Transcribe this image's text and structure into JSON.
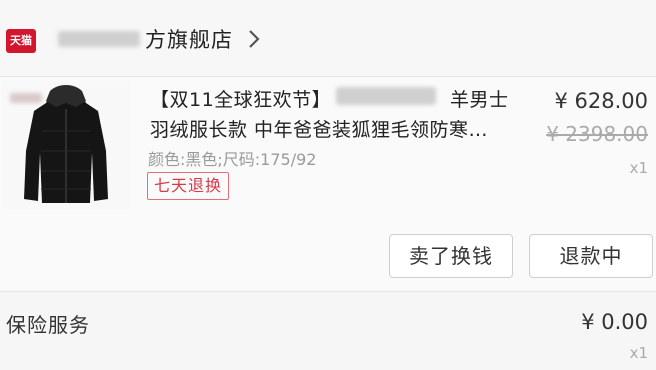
{
  "store": {
    "logo_text": "天猫",
    "name": "方旗舰店"
  },
  "product": {
    "title_line1_start": "【双11全球狂欢节】",
    "title_line1_end": "羊男士",
    "title_line2": "羽绒服长款 中年爸爸装狐狸毛领防寒…",
    "spec": "颜色:黑色;尺码:175/92",
    "return_tag": "七天退换",
    "price": "¥ 628.00",
    "original_price": "¥ 2398.00",
    "quantity": "x1"
  },
  "actions": {
    "sell_label": "卖了换钱",
    "refund_label": "退款中"
  },
  "service": {
    "label": "保险服务",
    "price": "¥ 0.00",
    "quantity": "x1"
  },
  "colors": {
    "tmall_red": "#d4152e",
    "tag_red": "#d63a48"
  }
}
